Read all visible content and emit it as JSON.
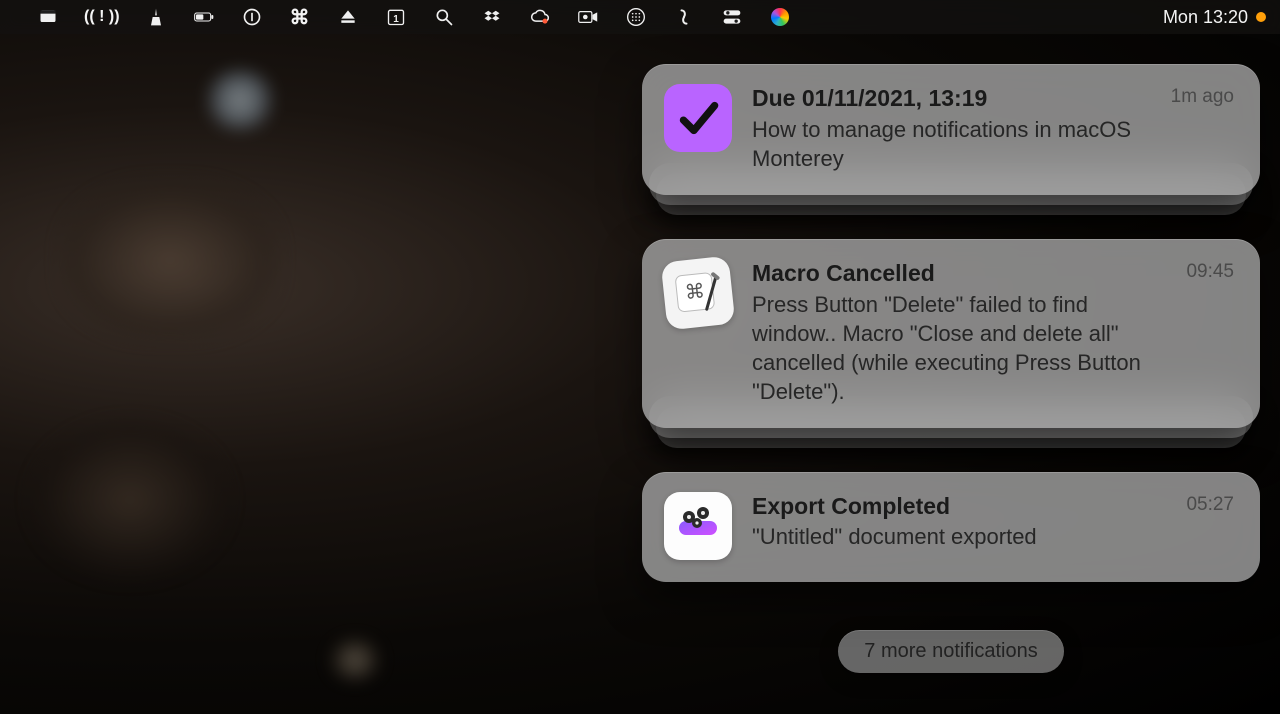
{
  "menubar": {
    "clock": "Mon 13:20",
    "icons": [
      "window-icon",
      "broadcast-icon",
      "clean-icon",
      "battery-icon",
      "onepassword-icon",
      "command-icon",
      "eject-icon",
      "calendar-icon",
      "search-icon",
      "dropbox-icon",
      "creative-cloud-icon",
      "recorder-icon",
      "keyboard-icon",
      "link-icon",
      "control-center-icon",
      "siri-icon"
    ],
    "calendar_day": "1"
  },
  "notifications": [
    {
      "app_icon": "omnifocus-check-icon",
      "title": "Due 01/11/2021, 13:19",
      "body": "How to manage notifications in macOS Monterey",
      "time": "1m ago",
      "stacked": true
    },
    {
      "app_icon": "keyboard-maestro-icon",
      "title": "Macro Cancelled",
      "body": "Press Button \"Delete\" failed to find window.. Macro \"Close and delete all\" cancelled (while executing Press Button \"Delete\").",
      "time": "09:45",
      "stacked": true
    },
    {
      "app_icon": "screenflow-icon",
      "title": "Export Completed",
      "body": "\"Untitled\" document exported",
      "time": "05:27",
      "stacked": false
    }
  ],
  "more_notifications": "7 more notifications"
}
